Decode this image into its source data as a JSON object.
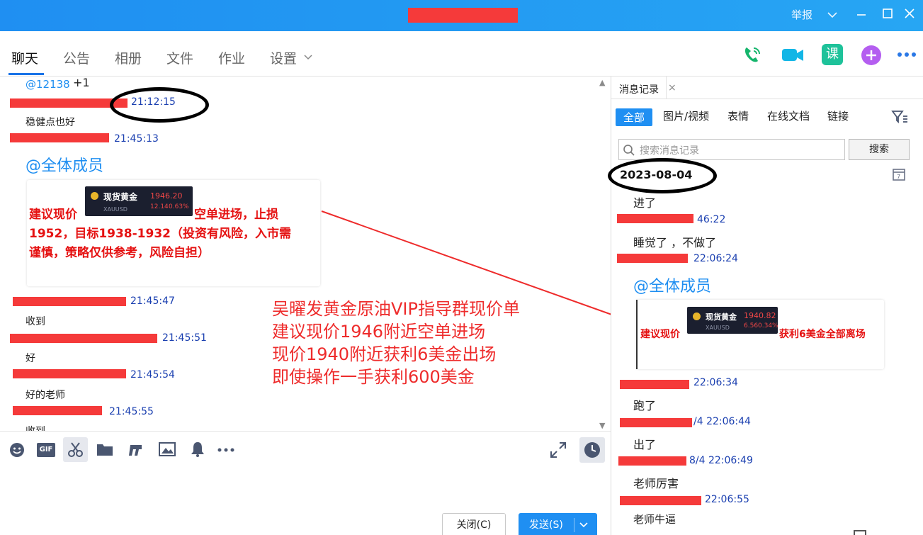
{
  "window": {
    "report_label": "举报",
    "chevron": "chevron-down-icon",
    "minimize": "minimize-icon",
    "maximize": "maximize-icon",
    "close": "close-icon",
    "accent": "#1f8ff2"
  },
  "tabs": [
    {
      "label": "聊天"
    },
    {
      "label": "公告"
    },
    {
      "label": "相册"
    },
    {
      "label": "文件"
    },
    {
      "label": "作业"
    },
    {
      "label": "设置"
    }
  ],
  "header_icons": {
    "phone": "phone-icon",
    "video": "video-icon",
    "lesson": "课",
    "add": "plus-icon",
    "more": "more-icon"
  },
  "chat": {
    "top_mention": "@12138",
    "top_plus": "+1",
    "messages": [
      {
        "time": "21:12:15",
        "text": "稳健点也好"
      },
      {
        "time": "21:45:13",
        "text": "@全体成员"
      },
      {
        "time": "21:45:47",
        "text": "收到"
      },
      {
        "time": "21:45:51",
        "text": "好"
      },
      {
        "time": "21:45:54",
        "text": "好的老师"
      },
      {
        "time": "21:45:55",
        "text": "收到"
      }
    ],
    "card": {
      "prefix": "建议现价",
      "suffix": "空单进场，止损",
      "line2": "1952，目标1938-1932（投资有风险，入市需",
      "line3": "谨慎，策略仅供参考，风险自担）",
      "ticker_name": "现货黄金",
      "ticker_symbol": "XAUUSD",
      "ticker_price": "1946.20",
      "ticker_change": "12.14",
      "ticker_pct": "0.63%"
    }
  },
  "annotation": {
    "line1": "吴曜发黄金原油VIP指导群现价单",
    "line2": "建议现价1946附近空单进场",
    "line3": "现价1940附近获利6美金出场",
    "line4": "即使操作一手获利600美金"
  },
  "toolbar": {
    "emoji": "emoji-icon",
    "gif": "GIF",
    "scissors": "scissors-icon",
    "folder": "folder-icon",
    "music": "music-icon",
    "image": "image-icon",
    "bell": "bell-icon",
    "more": "more-icon",
    "expand": "expand-icon",
    "history": "clock-icon"
  },
  "actions": {
    "close_label": "关闭(C)",
    "send_label": "发送(S)"
  },
  "sidebar": {
    "tab_label": "消息记录",
    "filters": [
      "全部",
      "图片/视频",
      "表情",
      "在线文档",
      "链接"
    ],
    "search_placeholder": "搜索消息记录",
    "search_button": "搜索",
    "date": "2023-08-04",
    "messages": [
      {
        "text": "进了",
        "time": "46:22"
      },
      {
        "text": "睡觉了 ，不做了",
        "time": "22:06:24"
      },
      {
        "text": "@全体成员",
        "time": "22:06:34"
      },
      {
        "text": "跑了",
        "time": "/4 22:06:44"
      },
      {
        "text": "出了",
        "time": "8/4 22:06:49"
      },
      {
        "text": "老师厉害",
        "time": "22:06:55"
      },
      {
        "text": "老师牛逼",
        "time": ""
      }
    ],
    "card": {
      "prefix": "建议现价",
      "suffix": "获利6美金全部离场",
      "ticker_name": "现货黄金",
      "ticker_symbol": "XAUUSD",
      "ticker_price": "1940.82",
      "ticker_change": "6.56",
      "ticker_pct": "0.34%"
    }
  }
}
